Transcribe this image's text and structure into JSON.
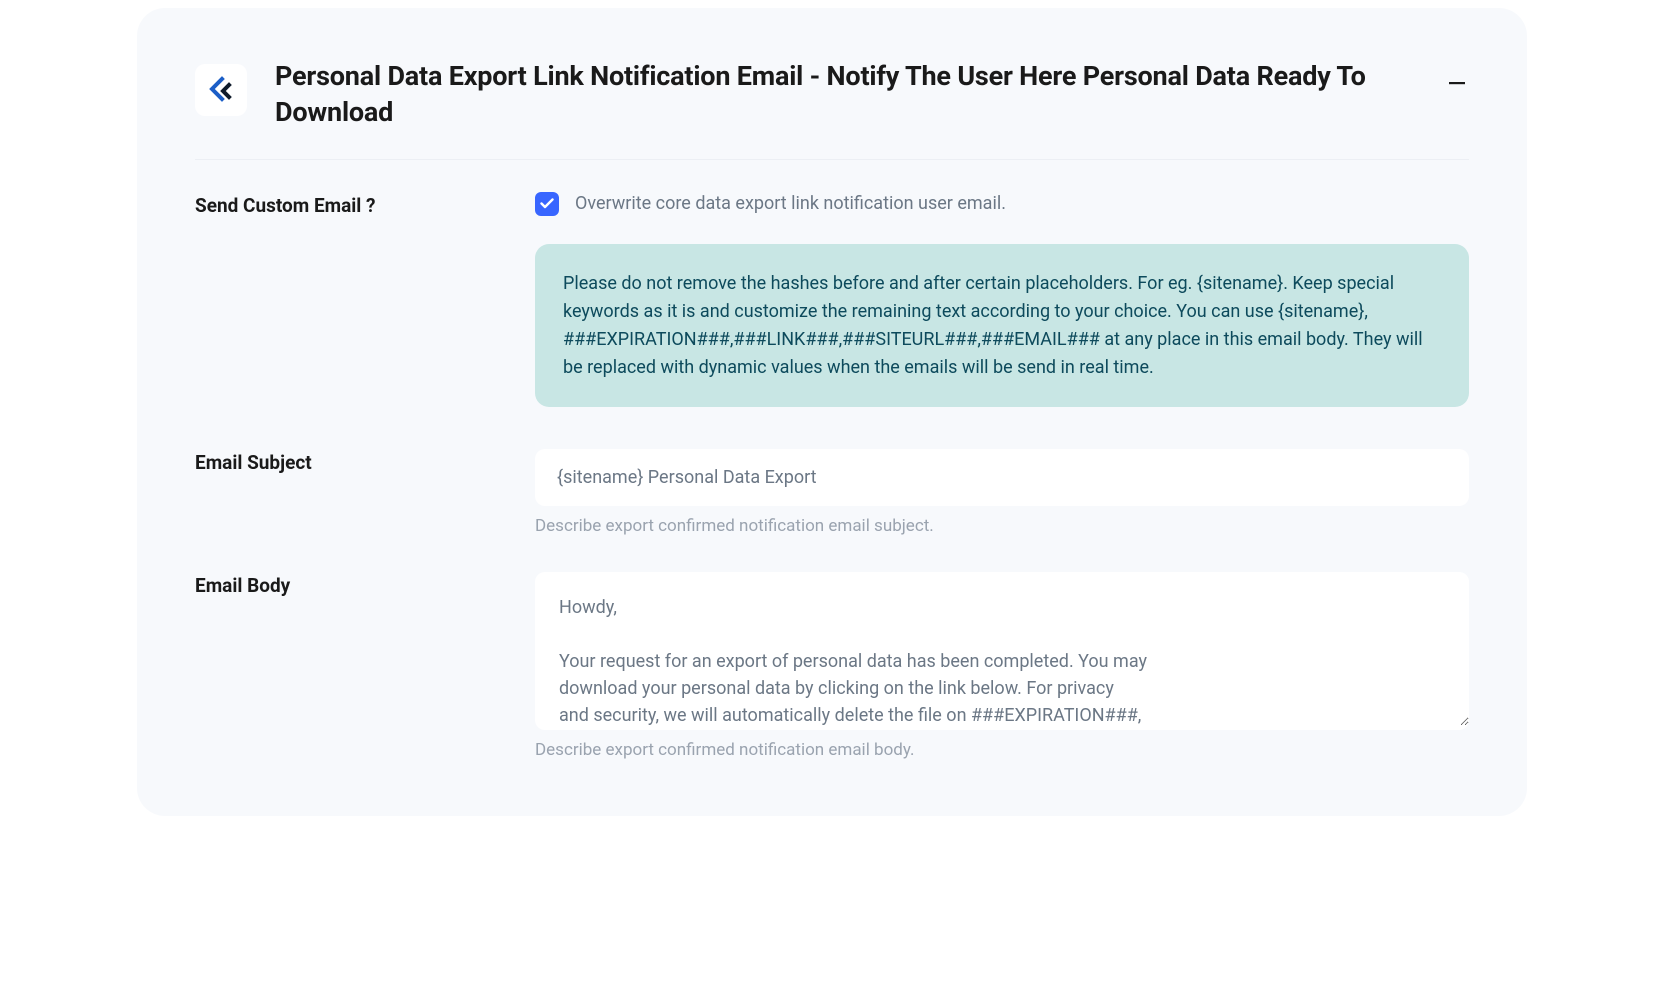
{
  "header": {
    "title": "Personal Data Export Link Notification Email - Notify The User Here Personal Data Ready To Download"
  },
  "sendCustom": {
    "label": "Send Custom Email ?",
    "checked": true,
    "checkbox_label": "Overwrite core data export link notification user email.",
    "info_text": "Please do not remove the hashes before and after certain placeholders. For eg. {sitename}. Keep special keywords as it is and customize the remaining text according to your choice. You can use {sitename}, ###EXPIRATION###,###LINK###,###SITEURL###,###EMAIL### at any place in this email body. They will be replaced with dynamic values when the emails will be send in real time."
  },
  "emailSubject": {
    "label": "Email Subject",
    "value": "{sitename} Personal Data Export",
    "helper": "Describe export confirmed notification email subject."
  },
  "emailBody": {
    "label": "Email Body",
    "value": "Howdy,\n\nYour request for an export of personal data has been completed. You may\ndownload your personal data by clicking on the link below. For privacy\nand security, we will automatically delete the file on ###EXPIRATION###,\nso please download it before then.",
    "helper": "Describe export confirmed notification email body."
  }
}
